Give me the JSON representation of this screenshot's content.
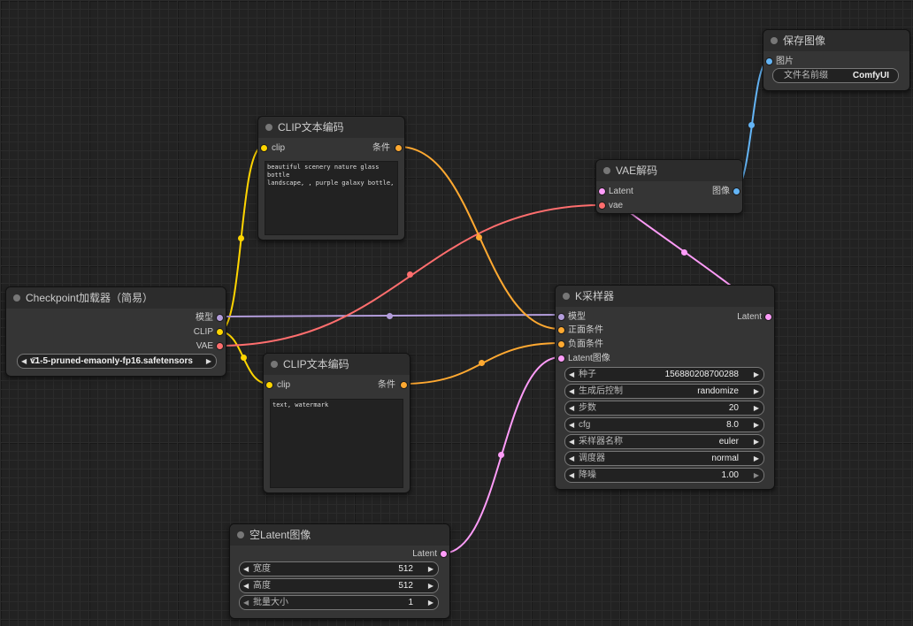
{
  "colors": {
    "model": "#b39ddb",
    "clip": "#ffd500",
    "vae": "#ff6e6e",
    "conditioning": "#ffa931",
    "latent": "#ff9cf9",
    "image": "#64b5f6"
  },
  "checkpoint": {
    "title": "Checkpoint加载器（简易）",
    "outputs": [
      "模型",
      "CLIP",
      "VAE"
    ],
    "ckpt": {
      "prefix": "C...",
      "value": "v1-5-pruned-emaonly-fp16.safetensors"
    }
  },
  "clip_pos": {
    "title": "CLIP文本编码",
    "input": "clip",
    "output": "条件",
    "text": "beautiful scenery nature glass bottle\nlandscape, , purple galaxy bottle,"
  },
  "clip_neg": {
    "title": "CLIP文本编码",
    "input": "clip",
    "output": "条件",
    "text": "text, watermark"
  },
  "vae_decode": {
    "title": "VAE解码",
    "inputs": [
      "Latent",
      "vae"
    ],
    "output": "图像"
  },
  "save_image": {
    "title": "保存图像",
    "input": "图片",
    "filename_prefix": {
      "name": "文件名前缀",
      "value": "ComfyUI"
    }
  },
  "ksampler": {
    "title": "K采样器",
    "inputs": [
      "模型",
      "正面条件",
      "负面条件",
      "Latent图像"
    ],
    "output": "Latent",
    "widgets": [
      {
        "name": "种子",
        "value": "156880208700288"
      },
      {
        "name": "生成后控制",
        "value": "randomize"
      },
      {
        "name": "步数",
        "value": "20"
      },
      {
        "name": "cfg",
        "value": "8.0"
      },
      {
        "name": "采样器名称",
        "value": "euler"
      },
      {
        "name": "调度器",
        "value": "normal"
      },
      {
        "name": "降噪",
        "value": "1.00"
      }
    ]
  },
  "empty_latent": {
    "title": "空Latent图像",
    "output": "Latent",
    "widgets": [
      {
        "name": "宽度",
        "value": "512"
      },
      {
        "name": "高度",
        "value": "512"
      },
      {
        "name": "批量大小",
        "value": "1"
      }
    ]
  }
}
